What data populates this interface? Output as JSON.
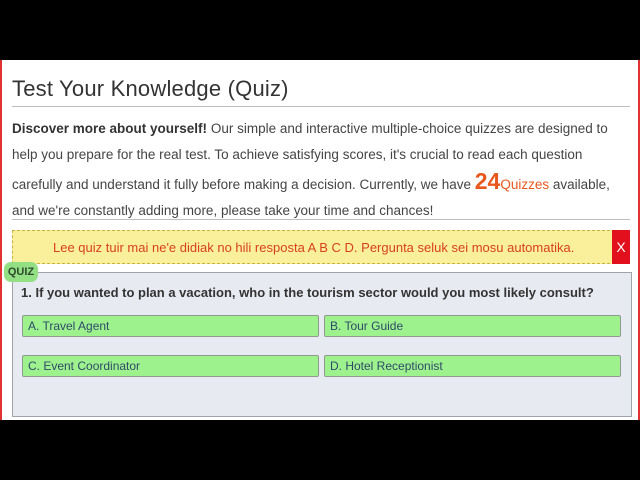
{
  "page": {
    "title": "Test Your Knowledge (Quiz)",
    "intro_bold": "Discover more about yourself!",
    "intro_part1": " Our simple and interactive multiple-choice quizzes are designed to help you prepare for the real test. To achieve satisfying scores, it's crucial to read each question carefully and understand it fully before making a decision. Currently, we have ",
    "quiz_count": "24",
    "quiz_count_label": "Quizzes",
    "intro_part2": " available, and we're constantly adding more, please take your time and chances!"
  },
  "notice": {
    "text": "Lee quiz tuir mai ne'e didiak no hili resposta A B C D. Pergunta seluk sei mosu automatika.",
    "close_label": "X"
  },
  "quiz": {
    "badge": "QUIZ",
    "question": "1. If you wanted to plan a vacation, who in the tourism sector would you most likely consult?",
    "options": [
      "A. Travel Agent",
      "B. Tour Guide",
      "C. Event Coordinator",
      "D. Hotel Receptionist"
    ]
  },
  "colors": {
    "accent": "#e8581c",
    "notice_bg": "#faf09b",
    "notice_text": "#d83f1f",
    "close_bg": "#e2101c",
    "option_bg": "#9ef28e",
    "quiz_bg": "#e8eaf1"
  }
}
